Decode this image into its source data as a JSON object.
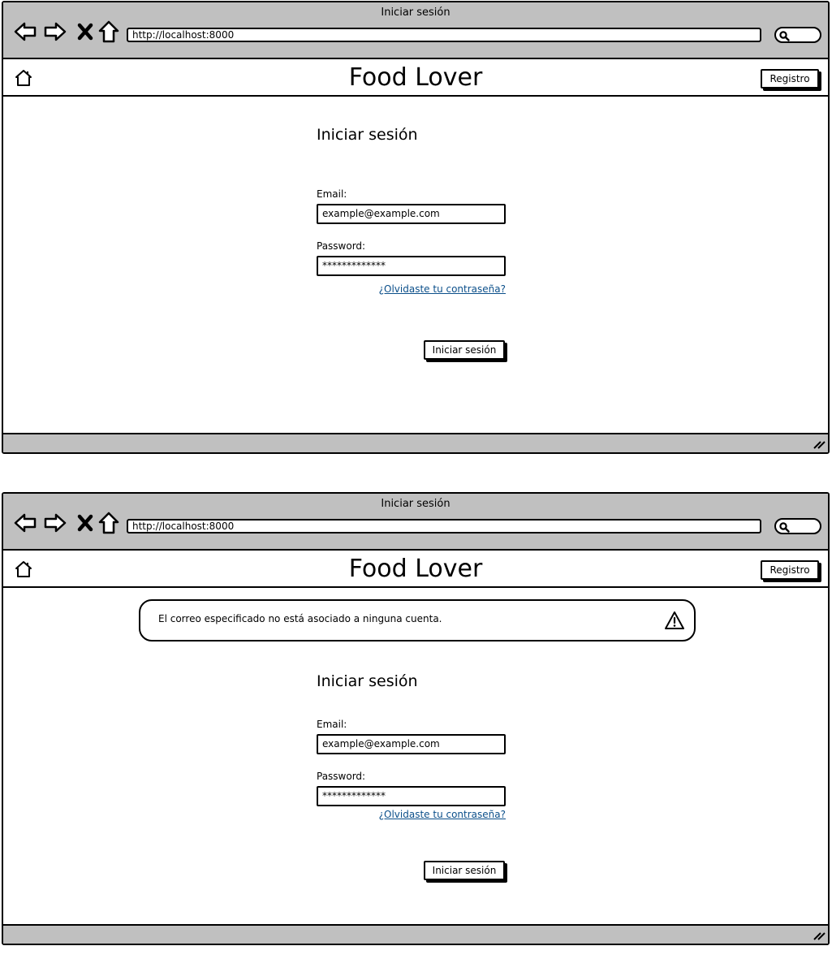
{
  "screens": [
    {
      "window_title": "Iniciar sesión",
      "url": "http://localhost:8000",
      "brand": "Food Lover",
      "register_label": "Registro",
      "form": {
        "title": "Iniciar sesión",
        "email_label": "Email:",
        "email_value": "example@example.com",
        "password_label": "Password:",
        "password_value": "*************",
        "forgot_link": "¿Olvidaste tu contraseña?",
        "submit_label": "Iniciar sesión"
      }
    },
    {
      "window_title": "Iniciar sesión",
      "url": "http://localhost:8000",
      "brand": "Food Lover",
      "register_label": "Registro",
      "alert": {
        "message": "El correo especificado no está asociado a ninguna cuenta.",
        "icon": "warning-icon"
      },
      "form": {
        "title": "Iniciar sesión",
        "email_label": "Email:",
        "email_value": "example@example.com",
        "password_label": "Password:",
        "password_value": "*************",
        "forgot_link": "¿Olvidaste tu contraseña?",
        "submit_label": "Iniciar sesión"
      }
    }
  ],
  "icons": [
    "back-icon",
    "forward-icon",
    "stop-icon",
    "home-icon",
    "search-icon",
    "resize-grip-icon"
  ],
  "colors": {
    "chrome": "#c0c0c0",
    "link": "#0b4f8a",
    "border": "#000000"
  }
}
